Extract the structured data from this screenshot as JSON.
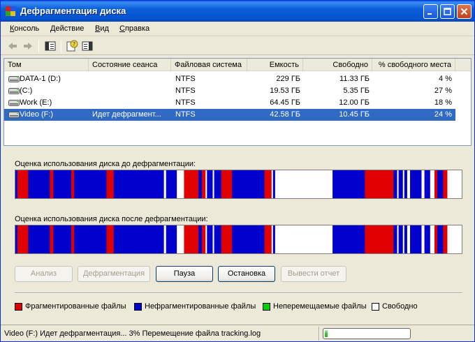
{
  "window": {
    "title": "Дефрагментация диска"
  },
  "menu": [
    {
      "label": "Консоль",
      "acc": "К",
      "rest": "онсоль"
    },
    {
      "label": "Действие",
      "acc": "Д",
      "rest": "ействие"
    },
    {
      "label": "Вид",
      "acc": "В",
      "rest": "ид"
    },
    {
      "label": "Справка",
      "acc": "С",
      "rest": "правка"
    }
  ],
  "toolbar_icons": [
    "back-arrow-icon",
    "forward-arrow-icon",
    "volume-view-icon",
    "help-icon",
    "properties-icon"
  ],
  "columns": [
    "Том",
    "Состояние сеанса",
    "Файловая система",
    "Емкость",
    "Свободно",
    "% свободного места"
  ],
  "volumes": [
    {
      "name": "DATA-1 (D:)",
      "status": "",
      "fs": "NTFS",
      "capacity": "229 ГБ",
      "free": "11.33 ГБ",
      "free_pct": "4 %"
    },
    {
      "name": "(C:)",
      "status": "",
      "fs": "NTFS",
      "capacity": "19.53 ГБ",
      "free": "5.35 ГБ",
      "free_pct": "27 %"
    },
    {
      "name": "Work (E:)",
      "status": "",
      "fs": "NTFS",
      "capacity": "64.45 ГБ",
      "free": "12.00 ГБ",
      "free_pct": "18 %"
    },
    {
      "name": "Video (F:)",
      "status": "Идет дефрагмент...",
      "fs": "NTFS",
      "capacity": "42.58 ГБ",
      "free": "10.45 ГБ",
      "free_pct": "24 %"
    }
  ],
  "selected_volume": 3,
  "analysis": {
    "before_label": "Оценка использования диска до дефрагментации:",
    "after_label": "Оценка использования диска после дефрагментации:"
  },
  "buttons": {
    "analyze": "Анализ",
    "defragment": "Дефрагментация",
    "pause": "Пауза",
    "stop": "Остановка",
    "report": "Вывести отчет"
  },
  "legend": {
    "fragmented": "Фрагментированные файлы",
    "contiguous": "Нефрагментированные файлы",
    "unmovable": "Неперемещаемые файлы",
    "free": "Свободно"
  },
  "colors": {
    "fragmented": "#e00000",
    "contiguous": "#0000cc",
    "unmovable": "#00d000",
    "free": "#ffffff",
    "selection": "#316ac5",
    "titlebar": "#0a5fd8"
  },
  "status": {
    "text": "Video (F:) Идет дефрагментация... 3%  Перемещение файла tracking.log",
    "progress_percent": 3
  }
}
